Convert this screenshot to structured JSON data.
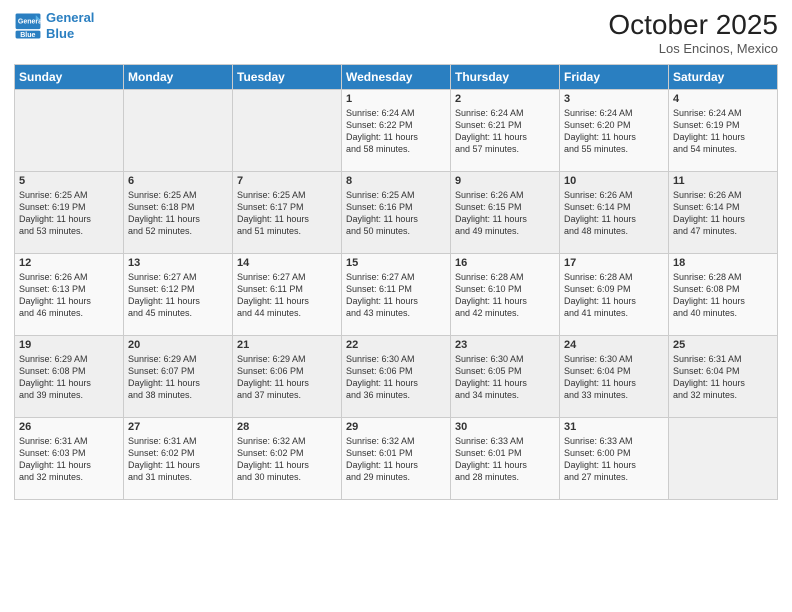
{
  "header": {
    "logo_line1": "General",
    "logo_line2": "Blue",
    "month": "October 2025",
    "location": "Los Encinos, Mexico"
  },
  "weekdays": [
    "Sunday",
    "Monday",
    "Tuesday",
    "Wednesday",
    "Thursday",
    "Friday",
    "Saturday"
  ],
  "weeks": [
    [
      {
        "day": "",
        "content": ""
      },
      {
        "day": "",
        "content": ""
      },
      {
        "day": "",
        "content": ""
      },
      {
        "day": "1",
        "content": "Sunrise: 6:24 AM\nSunset: 6:22 PM\nDaylight: 11 hours\nand 58 minutes."
      },
      {
        "day": "2",
        "content": "Sunrise: 6:24 AM\nSunset: 6:21 PM\nDaylight: 11 hours\nand 57 minutes."
      },
      {
        "day": "3",
        "content": "Sunrise: 6:24 AM\nSunset: 6:20 PM\nDaylight: 11 hours\nand 55 minutes."
      },
      {
        "day": "4",
        "content": "Sunrise: 6:24 AM\nSunset: 6:19 PM\nDaylight: 11 hours\nand 54 minutes."
      }
    ],
    [
      {
        "day": "5",
        "content": "Sunrise: 6:25 AM\nSunset: 6:19 PM\nDaylight: 11 hours\nand 53 minutes."
      },
      {
        "day": "6",
        "content": "Sunrise: 6:25 AM\nSunset: 6:18 PM\nDaylight: 11 hours\nand 52 minutes."
      },
      {
        "day": "7",
        "content": "Sunrise: 6:25 AM\nSunset: 6:17 PM\nDaylight: 11 hours\nand 51 minutes."
      },
      {
        "day": "8",
        "content": "Sunrise: 6:25 AM\nSunset: 6:16 PM\nDaylight: 11 hours\nand 50 minutes."
      },
      {
        "day": "9",
        "content": "Sunrise: 6:26 AM\nSunset: 6:15 PM\nDaylight: 11 hours\nand 49 minutes."
      },
      {
        "day": "10",
        "content": "Sunrise: 6:26 AM\nSunset: 6:14 PM\nDaylight: 11 hours\nand 48 minutes."
      },
      {
        "day": "11",
        "content": "Sunrise: 6:26 AM\nSunset: 6:14 PM\nDaylight: 11 hours\nand 47 minutes."
      }
    ],
    [
      {
        "day": "12",
        "content": "Sunrise: 6:26 AM\nSunset: 6:13 PM\nDaylight: 11 hours\nand 46 minutes."
      },
      {
        "day": "13",
        "content": "Sunrise: 6:27 AM\nSunset: 6:12 PM\nDaylight: 11 hours\nand 45 minutes."
      },
      {
        "day": "14",
        "content": "Sunrise: 6:27 AM\nSunset: 6:11 PM\nDaylight: 11 hours\nand 44 minutes."
      },
      {
        "day": "15",
        "content": "Sunrise: 6:27 AM\nSunset: 6:11 PM\nDaylight: 11 hours\nand 43 minutes."
      },
      {
        "day": "16",
        "content": "Sunrise: 6:28 AM\nSunset: 6:10 PM\nDaylight: 11 hours\nand 42 minutes."
      },
      {
        "day": "17",
        "content": "Sunrise: 6:28 AM\nSunset: 6:09 PM\nDaylight: 11 hours\nand 41 minutes."
      },
      {
        "day": "18",
        "content": "Sunrise: 6:28 AM\nSunset: 6:08 PM\nDaylight: 11 hours\nand 40 minutes."
      }
    ],
    [
      {
        "day": "19",
        "content": "Sunrise: 6:29 AM\nSunset: 6:08 PM\nDaylight: 11 hours\nand 39 minutes."
      },
      {
        "day": "20",
        "content": "Sunrise: 6:29 AM\nSunset: 6:07 PM\nDaylight: 11 hours\nand 38 minutes."
      },
      {
        "day": "21",
        "content": "Sunrise: 6:29 AM\nSunset: 6:06 PM\nDaylight: 11 hours\nand 37 minutes."
      },
      {
        "day": "22",
        "content": "Sunrise: 6:30 AM\nSunset: 6:06 PM\nDaylight: 11 hours\nand 36 minutes."
      },
      {
        "day": "23",
        "content": "Sunrise: 6:30 AM\nSunset: 6:05 PM\nDaylight: 11 hours\nand 34 minutes."
      },
      {
        "day": "24",
        "content": "Sunrise: 6:30 AM\nSunset: 6:04 PM\nDaylight: 11 hours\nand 33 minutes."
      },
      {
        "day": "25",
        "content": "Sunrise: 6:31 AM\nSunset: 6:04 PM\nDaylight: 11 hours\nand 32 minutes."
      }
    ],
    [
      {
        "day": "26",
        "content": "Sunrise: 6:31 AM\nSunset: 6:03 PM\nDaylight: 11 hours\nand 32 minutes."
      },
      {
        "day": "27",
        "content": "Sunrise: 6:31 AM\nSunset: 6:02 PM\nDaylight: 11 hours\nand 31 minutes."
      },
      {
        "day": "28",
        "content": "Sunrise: 6:32 AM\nSunset: 6:02 PM\nDaylight: 11 hours\nand 30 minutes."
      },
      {
        "day": "29",
        "content": "Sunrise: 6:32 AM\nSunset: 6:01 PM\nDaylight: 11 hours\nand 29 minutes."
      },
      {
        "day": "30",
        "content": "Sunrise: 6:33 AM\nSunset: 6:01 PM\nDaylight: 11 hours\nand 28 minutes."
      },
      {
        "day": "31",
        "content": "Sunrise: 6:33 AM\nSunset: 6:00 PM\nDaylight: 11 hours\nand 27 minutes."
      },
      {
        "day": "",
        "content": ""
      }
    ]
  ]
}
